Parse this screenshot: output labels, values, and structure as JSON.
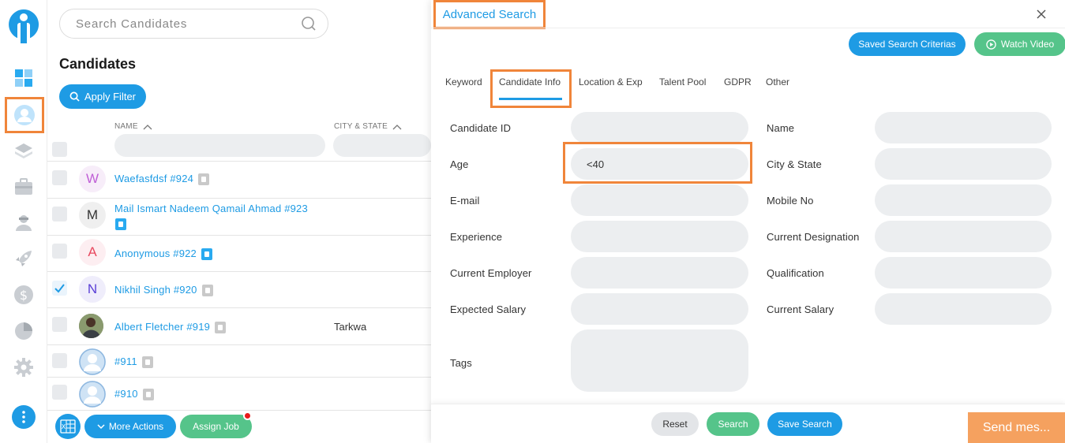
{
  "colors": {
    "primary": "#1e9be4",
    "success": "#55c48a",
    "highlight": "#f0853a",
    "chat": "#f5a15f",
    "alert": "#e81b1b"
  },
  "rail": {
    "items": [
      "dashboard-icon",
      "candidates-icon",
      "layers-icon",
      "briefcase-icon",
      "user-icon",
      "rocket-icon",
      "dollar-icon",
      "pie-chart-icon",
      "gear-icon"
    ],
    "active": "candidates-icon"
  },
  "list": {
    "search_placeholder": "Search Candidates",
    "title": "Candidates",
    "apply_filter": "Apply Filter",
    "columns": {
      "name": "NAME",
      "city": "CITY & STATE"
    },
    "rows": [
      {
        "initial": "W",
        "name": "Waefasfdsf #924",
        "doc": "grey",
        "checked": false
      },
      {
        "initial": "M",
        "name": "Mail Ismart Nadeem Qamail Ahmad #923",
        "doc": "blue",
        "checked": false
      },
      {
        "initial": "A",
        "name": "Anonymous #922",
        "doc": "blue",
        "checked": false
      },
      {
        "initial": "N",
        "name": "Nikhil Singh #920",
        "doc": "grey",
        "checked": true
      },
      {
        "initial": "",
        "name": "Albert Fletcher #919",
        "doc": "grey",
        "checked": false,
        "city": "Tarkwa"
      },
      {
        "initial": "",
        "name": "#911",
        "doc": "grey",
        "checked": false
      },
      {
        "initial": "",
        "name": "#910",
        "doc": "grey",
        "checked": false
      }
    ],
    "more_actions": "More Actions",
    "assign_job": "Assign Job"
  },
  "panel": {
    "title": "Advanced Search",
    "saved_search": "Saved Search Criterias",
    "watch_video": "Watch Video",
    "tabs": [
      "Keyword",
      "Candidate Info",
      "Location & Exp",
      "Talent Pool",
      "GDPR",
      "Other"
    ],
    "active_tab": "Candidate Info",
    "fields": {
      "candidate_id": {
        "label": "Candidate ID",
        "value": ""
      },
      "name": {
        "label": "Name",
        "value": ""
      },
      "age": {
        "label": "Age",
        "value": "<40"
      },
      "city_state": {
        "label": "City & State",
        "value": ""
      },
      "email": {
        "label": "E-mail",
        "value": ""
      },
      "mobile": {
        "label": "Mobile No",
        "value": ""
      },
      "experience": {
        "label": "Experience",
        "value": ""
      },
      "current_designation": {
        "label": "Current Designation",
        "value": ""
      },
      "current_employer": {
        "label": "Current Employer",
        "value": ""
      },
      "qualification": {
        "label": "Qualification",
        "value": ""
      },
      "expected_salary": {
        "label": "Expected Salary",
        "value": ""
      },
      "current_salary": {
        "label": "Current Salary",
        "value": ""
      },
      "tags": {
        "label": "Tags",
        "value": ""
      }
    },
    "reset": "Reset",
    "search": "Search",
    "save_search": "Save Search",
    "send_message": "Send mes..."
  }
}
